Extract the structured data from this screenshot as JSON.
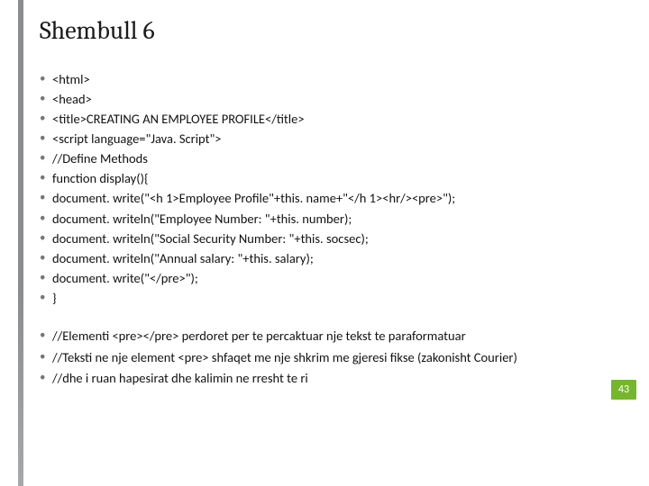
{
  "title": "Shembull 6",
  "code_lines": [
    "<html>",
    "<head>",
    "<title>CREATING AN EMPLOYEE PROFILE</title>",
    "<script language=\"Java. Script\">",
    "//Define Methods",
    "function display(){",
    "document. write(\"<h 1>Employee Profile\"+this. name+\"</h 1><hr/><pre>\");",
    "document. writeln(\"Employee Number: \"+this. number);",
    "document. writeln(\"Social Security Number: \"+this. socsec);",
    "document. writeln(\"Annual salary: \"+this. salary);",
    "document. write(\"</pre>\");",
    "}"
  ],
  "notes": [
    "//Elementi <pre></pre> perdoret per te percaktuar nje tekst te paraformatuar",
    "//Teksti ne nje element <pre> shfaqet me nje shkrim me gjeresi fikse (zakonisht Courier)",
    "//dhe i ruan hapesirat dhe kalimin ne rresht te ri"
  ],
  "page_number": "43"
}
